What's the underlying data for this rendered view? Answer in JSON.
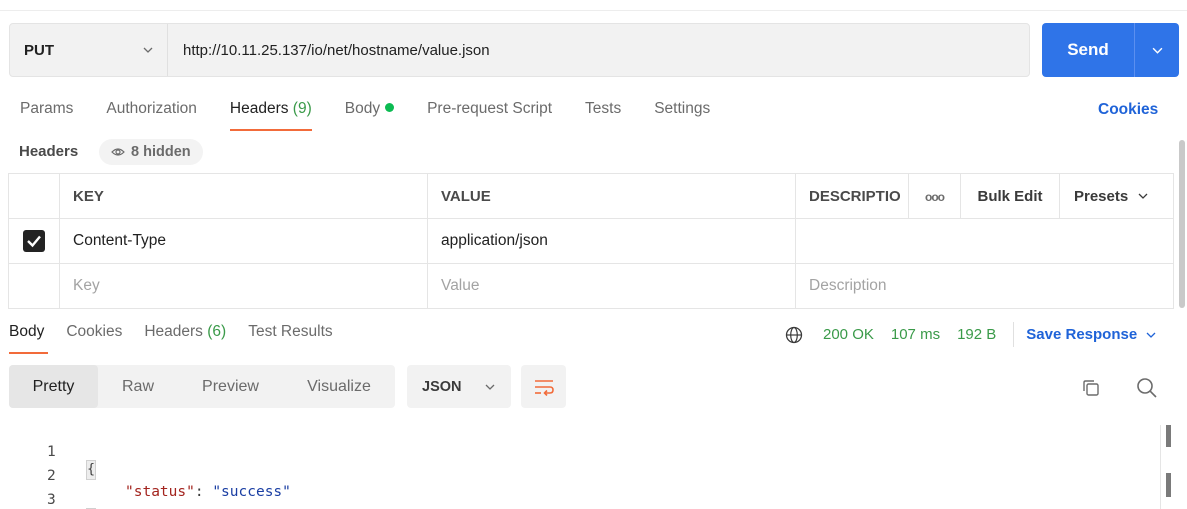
{
  "request": {
    "method": "PUT",
    "url": "http://10.11.25.137/io/net/hostname/value.json",
    "send_label": "Send"
  },
  "request_tabs": [
    {
      "label": "Params",
      "count": ""
    },
    {
      "label": "Authorization",
      "count": ""
    },
    {
      "label": "Headers",
      "count": "(9)"
    },
    {
      "label": "Body",
      "count": ""
    },
    {
      "label": "Pre-request Script",
      "count": ""
    },
    {
      "label": "Tests",
      "count": ""
    },
    {
      "label": "Settings",
      "count": ""
    }
  ],
  "cookies_label": "Cookies",
  "headers_section": {
    "label": "Headers",
    "hidden_label": "8 hidden"
  },
  "table": {
    "columns": {
      "key": "KEY",
      "value": "VALUE",
      "description": "DESCRIPTIO",
      "more": "ooo",
      "bulk_edit": "Bulk Edit",
      "presets": "Presets"
    },
    "rows": [
      {
        "checked": true,
        "key": "Content-Type",
        "value": "application/json",
        "description": ""
      }
    ],
    "placeholder": {
      "key": "Key",
      "value": "Value",
      "description": "Description"
    }
  },
  "response_tabs": [
    {
      "label": "Body",
      "count": ""
    },
    {
      "label": "Cookies",
      "count": ""
    },
    {
      "label": "Headers",
      "count": "(6)"
    },
    {
      "label": "Test Results",
      "count": ""
    }
  ],
  "response_meta": {
    "status": "200 OK",
    "time": "107 ms",
    "size": "192 B",
    "save_label": "Save Response"
  },
  "view_modes": [
    "Pretty",
    "Raw",
    "Preview",
    "Visualize"
  ],
  "format": "JSON",
  "code": {
    "line_numbers": [
      "1",
      "2",
      "3"
    ],
    "open": "{",
    "key": "\"status\"",
    "colon": ": ",
    "value": "\"success\"",
    "close": "}"
  },
  "colors": {
    "accent": "#2f74e8",
    "tab_underline": "#f26b3a",
    "status_green": "#3a9a49",
    "link_blue": "#1f63d8"
  }
}
